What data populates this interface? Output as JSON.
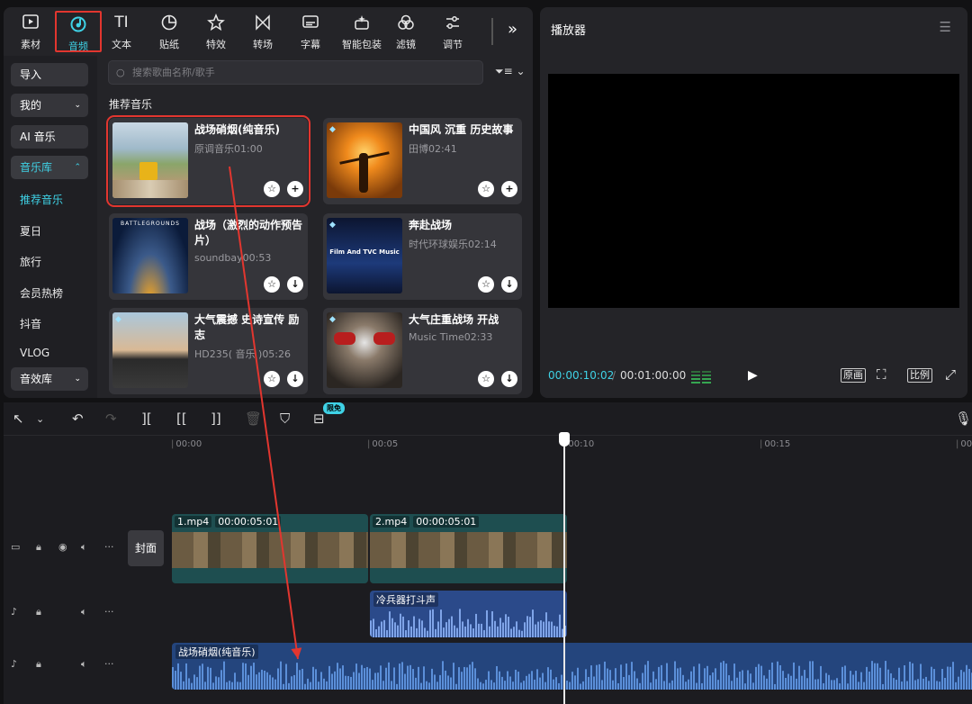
{
  "toolbar": {
    "items": [
      {
        "label": "素材",
        "icon": "media-icon"
      },
      {
        "label": "音频",
        "icon": "audio-icon"
      },
      {
        "label": "文本",
        "icon": "text-icon"
      },
      {
        "label": "贴纸",
        "icon": "sticker-icon"
      },
      {
        "label": "特效",
        "icon": "effects-icon"
      },
      {
        "label": "转场",
        "icon": "transition-icon"
      },
      {
        "label": "字幕",
        "icon": "subtitle-icon"
      },
      {
        "label": "智能包装",
        "icon": "smart-pack-icon"
      },
      {
        "label": "滤镜",
        "icon": "filter-icon"
      },
      {
        "label": "调节",
        "icon": "adjust-icon"
      }
    ],
    "more": "»"
  },
  "sidebar": {
    "import": "导入",
    "mine": "我的",
    "ai_music": "AI 音乐",
    "library": "音乐库",
    "items": [
      "推荐音乐",
      "夏日",
      "旅行",
      "会员热榜",
      "抖音",
      "VLOG"
    ],
    "sfx": "音效库"
  },
  "search": {
    "placeholder": "搜索歌曲名称/歌手"
  },
  "section_title": "推荐音乐",
  "cards": [
    {
      "title": "战场硝烟(纯音乐)",
      "subtitle": "原调音乐01:00",
      "btn1": "☆",
      "btn2": "+"
    },
    {
      "title": "中国风 沉重 历史故事",
      "subtitle": "田博02:41",
      "btn1": "☆",
      "btn2": "+"
    },
    {
      "title": "战场（激烈的动作预告片）",
      "subtitle": "soundbay00:53",
      "btn1": "☆",
      "btn2": "↓",
      "thumb_text": "BATTLEGROUNDS"
    },
    {
      "title": "奔赴战场",
      "subtitle": "时代环球娱乐02:14",
      "btn1": "☆",
      "btn2": "↓",
      "thumb_text": "Film And TVC Music"
    },
    {
      "title": "大气震撼 史诗宣传 励志",
      "subtitle": "HD235( 音乐 )05:26",
      "btn1": "☆",
      "btn2": "↓"
    },
    {
      "title": "大气庄重战场  开战",
      "subtitle": "Music Time02:33",
      "btn1": "☆",
      "btn2": "↓"
    }
  ],
  "player": {
    "title": "播放器",
    "current_time": "00:00:10:02",
    "separator": "/",
    "total_time": "00:01:00:00",
    "btn_original": "原画",
    "btn_ratio": "比例"
  },
  "timeline": {
    "limited_badge": "限免",
    "ticks": [
      "00:00",
      "00:05",
      "00:10",
      "00:15",
      "00"
    ],
    "cover_label": "封面",
    "video_clips": [
      {
        "name": "1.mp4",
        "duration": "00:00:05:01"
      },
      {
        "name": "2.mp4",
        "duration": "00:00:05:01"
      }
    ],
    "audio_clips": [
      {
        "name": "冷兵器打斗声"
      },
      {
        "name": "战场硝烟(纯音乐)"
      }
    ]
  },
  "colors": {
    "accent": "#3fd2e6",
    "highlight": "#e2362f",
    "audio_clip": "#24457d",
    "video_clip": "#1e4e50"
  }
}
